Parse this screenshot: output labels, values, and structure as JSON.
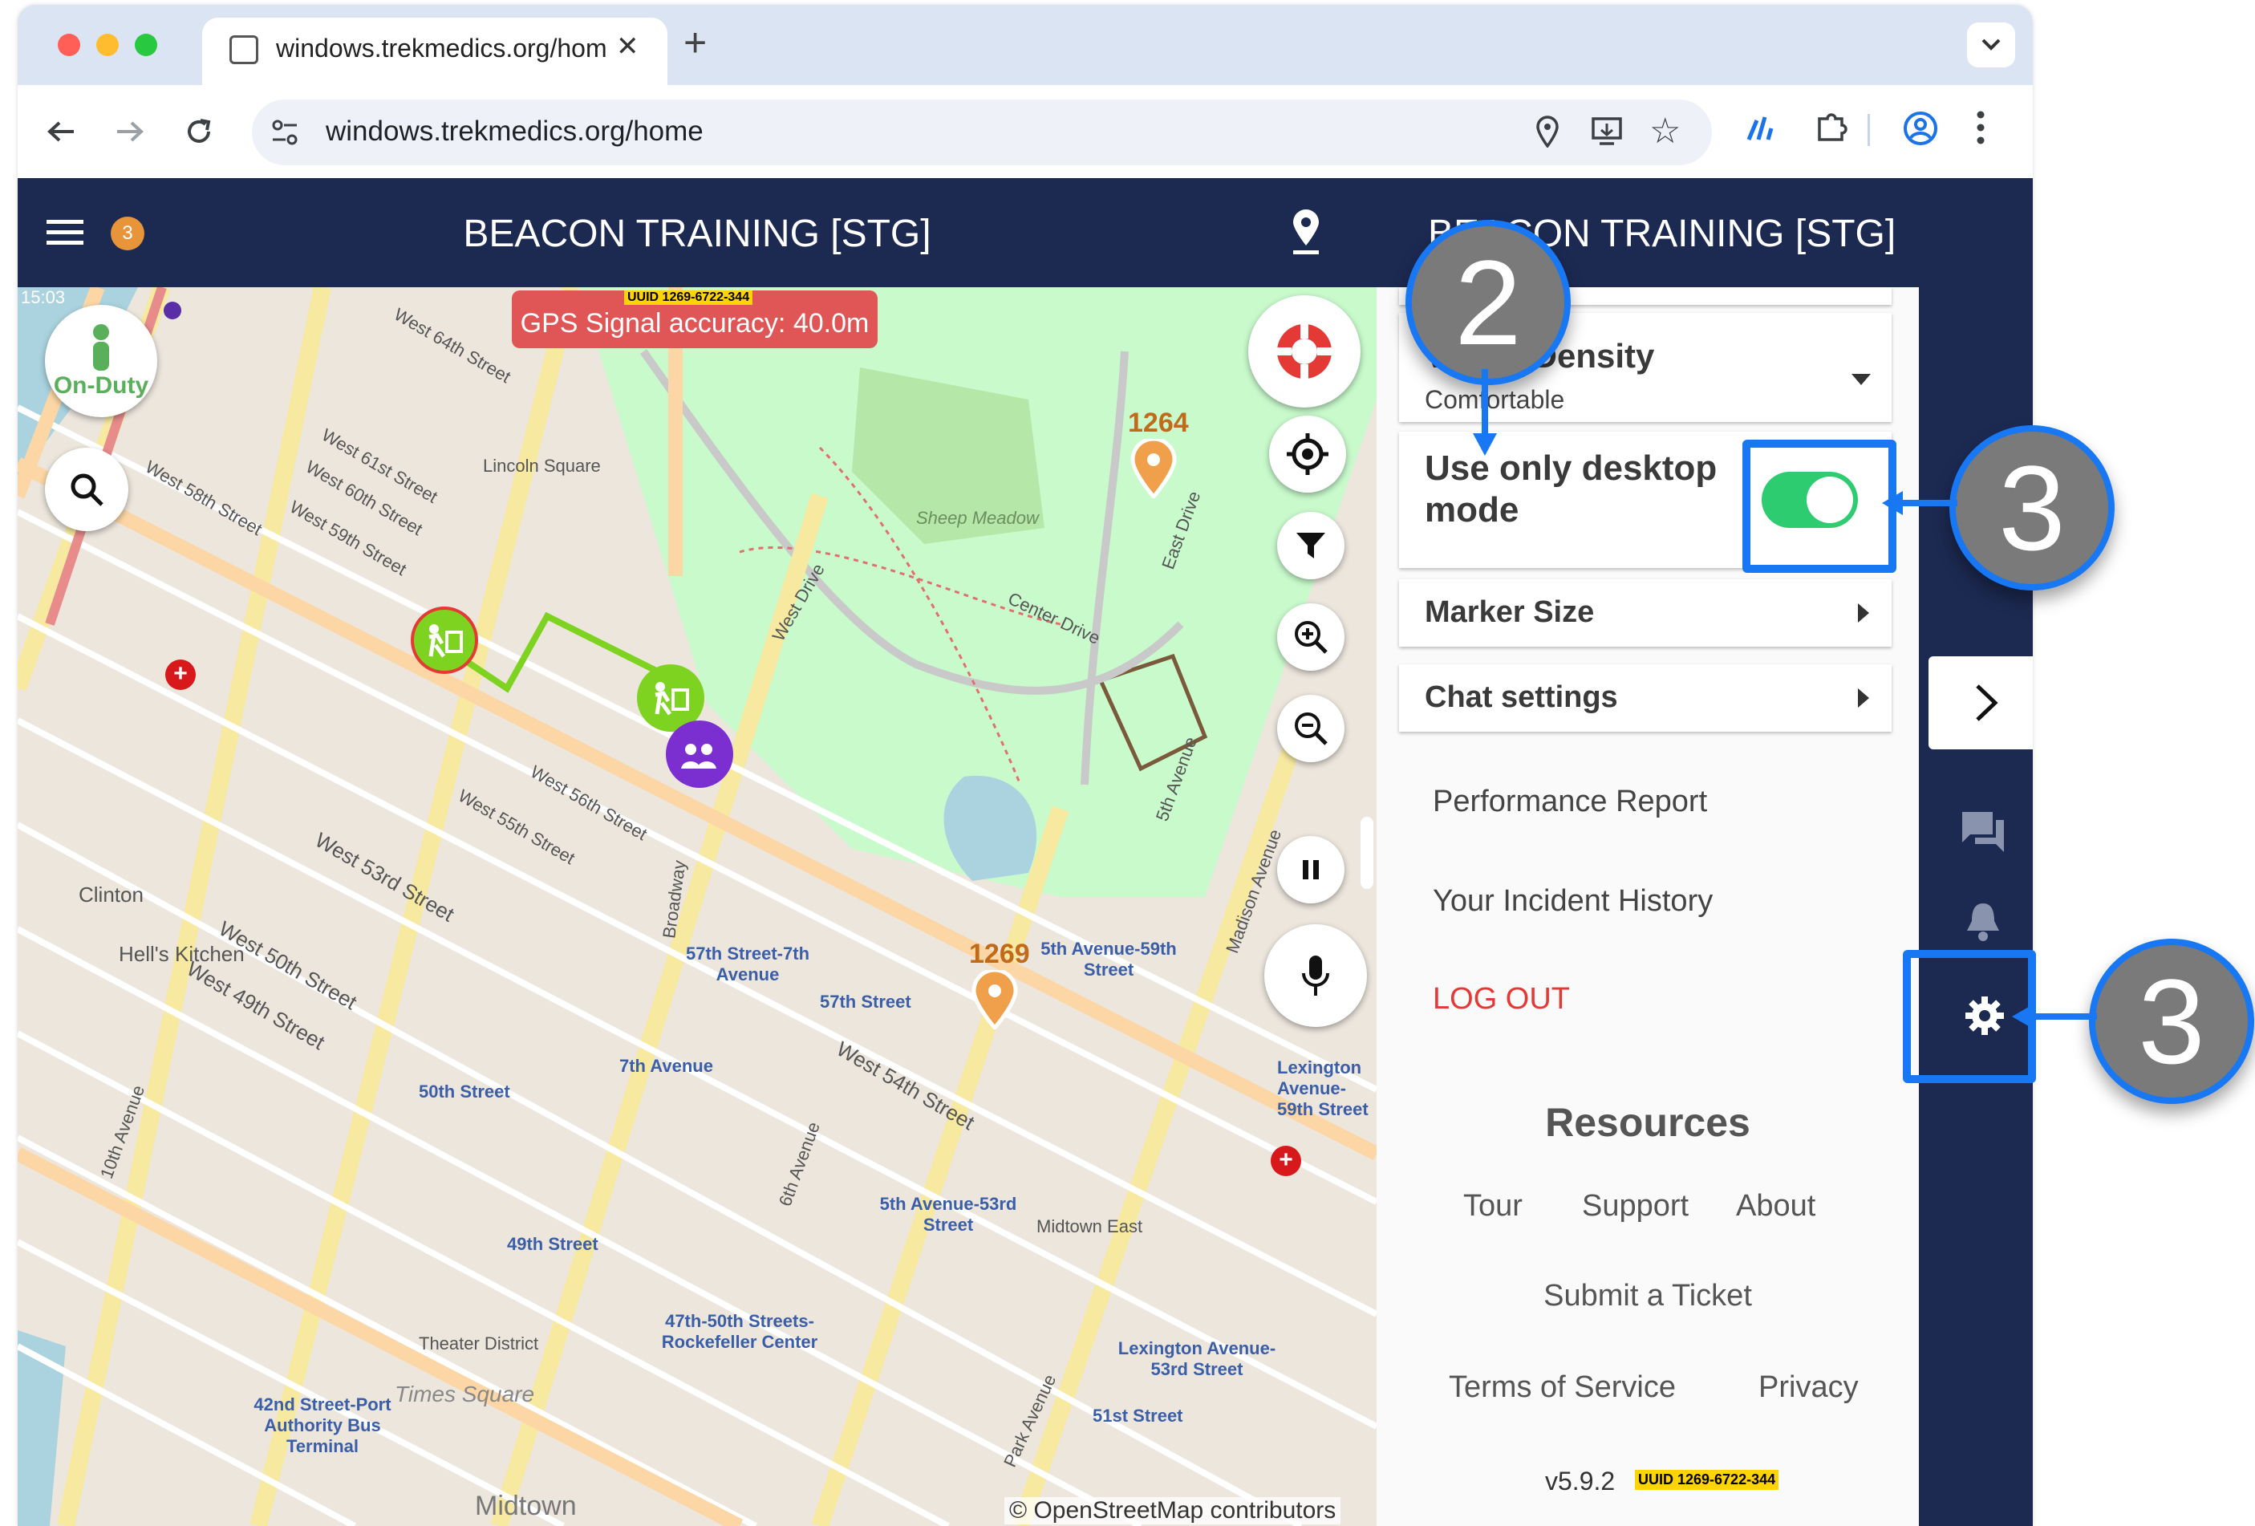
{
  "browser": {
    "tab_title": "windows.trekmedics.org/hom",
    "url": "windows.trekmedics.org/home",
    "new_tab": "+",
    "close_tab": "✕"
  },
  "app": {
    "title": "BEACON TRAINING [STG]",
    "panel_title": "BEACON TRAINING [STG]",
    "notification_count": "3",
    "clock": "15:03",
    "status_badge": "On-Duty",
    "gps_banner": "GPS Signal accuracy: 40.0m",
    "uuid_tag": "UUID 1269-6722-344",
    "attribution": "© OpenStreetMap contributors"
  },
  "map": {
    "labels": [
      "West 64th Street",
      "Lincoln Square",
      "West 61st Street",
      "West 60th Street",
      "West 59th Street",
      "West 58th Street",
      "Sheep Meadow",
      "West Drive",
      "Center Drive",
      "East Drive",
      "5th Avenue",
      "Madison Avenue",
      "Clinton",
      "Hell's Kitchen",
      "West 50th Street",
      "West 49th Street",
      "West 53rd Street",
      "West 55th Street",
      "West 56th Street",
      "57th Street-7th Avenue",
      "57th Street",
      "5th Avenue-59th Street",
      "7th Avenue",
      "50th Street",
      "West 54th Street",
      "5th Avenue-53rd Street",
      "Midtown East",
      "49th Street",
      "Theater District",
      "47th-50th Streets-Rockefeller Center",
      "Lexington Avenue-53rd Street",
      "51st Street",
      "42nd Street-Port Authority Bus Terminal",
      "Times Square",
      "Midtown",
      "Park Avenue",
      "Broadway",
      "10th Avenue",
      "6th Avenue",
      "Lexington Avenue-59th Street"
    ],
    "markers": [
      {
        "id": "incident-1264",
        "label": "1264"
      },
      {
        "id": "incident-1269",
        "label": "1269"
      }
    ]
  },
  "settings": {
    "density_label": "Visual Density",
    "density_value": "Comfortable",
    "desktop_label": "Use only desktop mode",
    "desktop_enabled": true,
    "marker_size": "Marker Size",
    "chat_settings": "Chat settings",
    "performance": "Performance Report",
    "incident_history": "Your Incident History",
    "logout": "LOG OUT",
    "resources_title": "Resources",
    "tour": "Tour",
    "support": "Support",
    "about": "About",
    "ticket": "Submit a Ticket",
    "terms": "Terms of Service",
    "privacy": "Privacy",
    "version": "v5.9.2",
    "version_tag": "UUID 1269-6722-344"
  },
  "callouts": {
    "step2": "2",
    "step3a": "3",
    "step3b": "3"
  },
  "colors": {
    "navy": "#1c2951",
    "accent": "#1877f2",
    "toggle": "#2ecc71",
    "logout": "#e53935",
    "gps": "#e05555"
  }
}
